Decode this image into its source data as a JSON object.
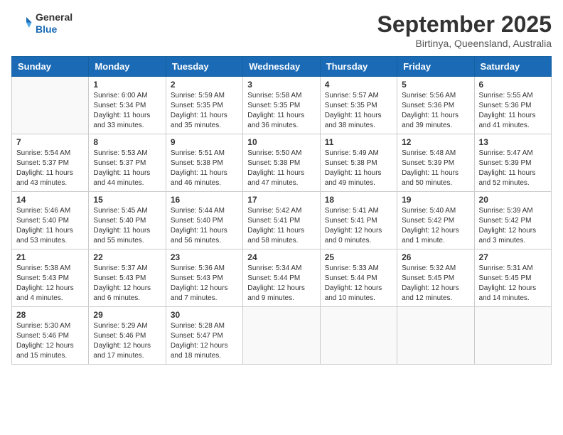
{
  "header": {
    "logo": {
      "general": "General",
      "blue": "Blue"
    },
    "month": "September 2025",
    "location": "Birtinya, Queensland, Australia"
  },
  "weekdays": [
    "Sunday",
    "Monday",
    "Tuesday",
    "Wednesday",
    "Thursday",
    "Friday",
    "Saturday"
  ],
  "weeks": [
    [
      {
        "day": "",
        "sunrise": "",
        "sunset": "",
        "daylight": ""
      },
      {
        "day": "1",
        "sunrise": "Sunrise: 6:00 AM",
        "sunset": "Sunset: 5:34 PM",
        "daylight": "Daylight: 11 hours and 33 minutes."
      },
      {
        "day": "2",
        "sunrise": "Sunrise: 5:59 AM",
        "sunset": "Sunset: 5:35 PM",
        "daylight": "Daylight: 11 hours and 35 minutes."
      },
      {
        "day": "3",
        "sunrise": "Sunrise: 5:58 AM",
        "sunset": "Sunset: 5:35 PM",
        "daylight": "Daylight: 11 hours and 36 minutes."
      },
      {
        "day": "4",
        "sunrise": "Sunrise: 5:57 AM",
        "sunset": "Sunset: 5:35 PM",
        "daylight": "Daylight: 11 hours and 38 minutes."
      },
      {
        "day": "5",
        "sunrise": "Sunrise: 5:56 AM",
        "sunset": "Sunset: 5:36 PM",
        "daylight": "Daylight: 11 hours and 39 minutes."
      },
      {
        "day": "6",
        "sunrise": "Sunrise: 5:55 AM",
        "sunset": "Sunset: 5:36 PM",
        "daylight": "Daylight: 11 hours and 41 minutes."
      }
    ],
    [
      {
        "day": "7",
        "sunrise": "Sunrise: 5:54 AM",
        "sunset": "Sunset: 5:37 PM",
        "daylight": "Daylight: 11 hours and 43 minutes."
      },
      {
        "day": "8",
        "sunrise": "Sunrise: 5:53 AM",
        "sunset": "Sunset: 5:37 PM",
        "daylight": "Daylight: 11 hours and 44 minutes."
      },
      {
        "day": "9",
        "sunrise": "Sunrise: 5:51 AM",
        "sunset": "Sunset: 5:38 PM",
        "daylight": "Daylight: 11 hours and 46 minutes."
      },
      {
        "day": "10",
        "sunrise": "Sunrise: 5:50 AM",
        "sunset": "Sunset: 5:38 PM",
        "daylight": "Daylight: 11 hours and 47 minutes."
      },
      {
        "day": "11",
        "sunrise": "Sunrise: 5:49 AM",
        "sunset": "Sunset: 5:38 PM",
        "daylight": "Daylight: 11 hours and 49 minutes."
      },
      {
        "day": "12",
        "sunrise": "Sunrise: 5:48 AM",
        "sunset": "Sunset: 5:39 PM",
        "daylight": "Daylight: 11 hours and 50 minutes."
      },
      {
        "day": "13",
        "sunrise": "Sunrise: 5:47 AM",
        "sunset": "Sunset: 5:39 PM",
        "daylight": "Daylight: 11 hours and 52 minutes."
      }
    ],
    [
      {
        "day": "14",
        "sunrise": "Sunrise: 5:46 AM",
        "sunset": "Sunset: 5:40 PM",
        "daylight": "Daylight: 11 hours and 53 minutes."
      },
      {
        "day": "15",
        "sunrise": "Sunrise: 5:45 AM",
        "sunset": "Sunset: 5:40 PM",
        "daylight": "Daylight: 11 hours and 55 minutes."
      },
      {
        "day": "16",
        "sunrise": "Sunrise: 5:44 AM",
        "sunset": "Sunset: 5:40 PM",
        "daylight": "Daylight: 11 hours and 56 minutes."
      },
      {
        "day": "17",
        "sunrise": "Sunrise: 5:42 AM",
        "sunset": "Sunset: 5:41 PM",
        "daylight": "Daylight: 11 hours and 58 minutes."
      },
      {
        "day": "18",
        "sunrise": "Sunrise: 5:41 AM",
        "sunset": "Sunset: 5:41 PM",
        "daylight": "Daylight: 12 hours and 0 minutes."
      },
      {
        "day": "19",
        "sunrise": "Sunrise: 5:40 AM",
        "sunset": "Sunset: 5:42 PM",
        "daylight": "Daylight: 12 hours and 1 minute."
      },
      {
        "day": "20",
        "sunrise": "Sunrise: 5:39 AM",
        "sunset": "Sunset: 5:42 PM",
        "daylight": "Daylight: 12 hours and 3 minutes."
      }
    ],
    [
      {
        "day": "21",
        "sunrise": "Sunrise: 5:38 AM",
        "sunset": "Sunset: 5:43 PM",
        "daylight": "Daylight: 12 hours and 4 minutes."
      },
      {
        "day": "22",
        "sunrise": "Sunrise: 5:37 AM",
        "sunset": "Sunset: 5:43 PM",
        "daylight": "Daylight: 12 hours and 6 minutes."
      },
      {
        "day": "23",
        "sunrise": "Sunrise: 5:36 AM",
        "sunset": "Sunset: 5:43 PM",
        "daylight": "Daylight: 12 hours and 7 minutes."
      },
      {
        "day": "24",
        "sunrise": "Sunrise: 5:34 AM",
        "sunset": "Sunset: 5:44 PM",
        "daylight": "Daylight: 12 hours and 9 minutes."
      },
      {
        "day": "25",
        "sunrise": "Sunrise: 5:33 AM",
        "sunset": "Sunset: 5:44 PM",
        "daylight": "Daylight: 12 hours and 10 minutes."
      },
      {
        "day": "26",
        "sunrise": "Sunrise: 5:32 AM",
        "sunset": "Sunset: 5:45 PM",
        "daylight": "Daylight: 12 hours and 12 minutes."
      },
      {
        "day": "27",
        "sunrise": "Sunrise: 5:31 AM",
        "sunset": "Sunset: 5:45 PM",
        "daylight": "Daylight: 12 hours and 14 minutes."
      }
    ],
    [
      {
        "day": "28",
        "sunrise": "Sunrise: 5:30 AM",
        "sunset": "Sunset: 5:46 PM",
        "daylight": "Daylight: 12 hours and 15 minutes."
      },
      {
        "day": "29",
        "sunrise": "Sunrise: 5:29 AM",
        "sunset": "Sunset: 5:46 PM",
        "daylight": "Daylight: 12 hours and 17 minutes."
      },
      {
        "day": "30",
        "sunrise": "Sunrise: 5:28 AM",
        "sunset": "Sunset: 5:47 PM",
        "daylight": "Daylight: 12 hours and 18 minutes."
      },
      {
        "day": "",
        "sunrise": "",
        "sunset": "",
        "daylight": ""
      },
      {
        "day": "",
        "sunrise": "",
        "sunset": "",
        "daylight": ""
      },
      {
        "day": "",
        "sunrise": "",
        "sunset": "",
        "daylight": ""
      },
      {
        "day": "",
        "sunrise": "",
        "sunset": "",
        "daylight": ""
      }
    ]
  ]
}
